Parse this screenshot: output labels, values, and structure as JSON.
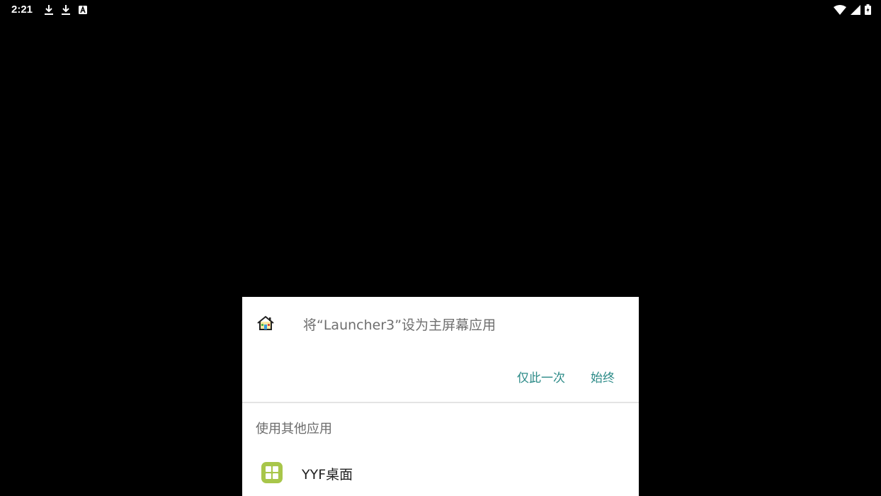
{
  "status_bar": {
    "time": "2:21",
    "left_icons": [
      "download-icon",
      "download-icon",
      "app-notification-icon"
    ],
    "right_icons": [
      "wifi-icon",
      "signal-icon",
      "battery-icon"
    ]
  },
  "dialog": {
    "icon": "home-icon",
    "title": "将“Launcher3”设为主屏幕应用",
    "just_once_label": "仅此一次",
    "always_label": "始终",
    "other_apps_label": "使用其他应用",
    "apps": [
      {
        "icon": "yyf-launcher-icon",
        "label": "YYF桌面"
      }
    ]
  },
  "colors": {
    "background": "#000000",
    "sheet": "#ffffff",
    "accent": "#2b8a87",
    "app_icon": "#a8c64a"
  }
}
